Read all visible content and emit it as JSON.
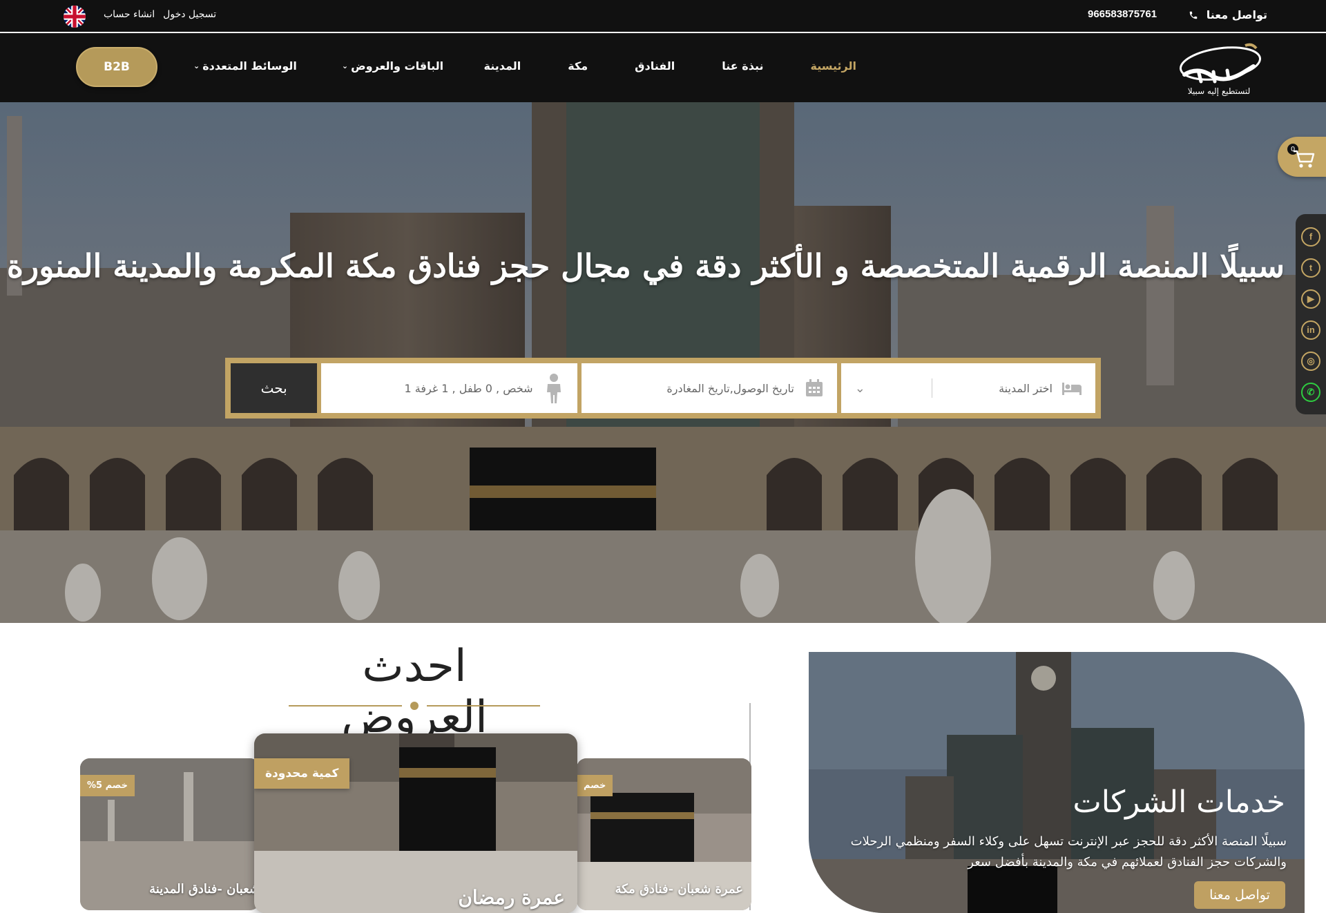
{
  "topbar": {
    "contact_label": "تواصل معنا",
    "phone": "966583875761",
    "login_label": "تسجيل دخول",
    "register_label": "انشاء حساب",
    "language_icon": "uk-flag-icon"
  },
  "logo": {
    "tagline": "لتستطيع إليه سبيلا"
  },
  "nav": {
    "items": [
      {
        "label": "الرئيسية",
        "active": true
      },
      {
        "label": "نبذة عنا"
      },
      {
        "label": "الفنادق"
      },
      {
        "label": "مكة"
      },
      {
        "label": "المدينة"
      },
      {
        "label": "الباقات والعروض",
        "dropdown": true
      },
      {
        "label": "الوسائط المتعددة",
        "dropdown": true
      }
    ],
    "b2b_label": "B2B"
  },
  "hero": {
    "title": "سبيلًا المنصة الرقمية المتخصصة و الأكثر دقة في مجال حجز فنادق مكة المكرمة والمدينة المنورة",
    "search": {
      "city_placeholder": "اختر المدينة",
      "dates_placeholder": "تاريخ الوصول,تاريخ المغادرة",
      "guests_value": "1 شخص , 0 طفل , 1 غرفة",
      "search_button": "بحث"
    }
  },
  "cart": {
    "count": "0"
  },
  "social": [
    "facebook-icon",
    "twitter-icon",
    "youtube-icon",
    "linkedin-icon",
    "instagram-icon",
    "whatsapp-icon"
  ],
  "offers": {
    "title": "احدث العروض",
    "cards": [
      {
        "badge": "خصم 5%",
        "caption": "شعبان -فنادق المدينة"
      },
      {
        "badge": "كمية محدودة",
        "caption": "عمرة رمضان"
      },
      {
        "badge": "خصم",
        "caption": "عمرة شعبان -فنادق مكة"
      }
    ]
  },
  "corporate": {
    "title": "خدمات الشركات",
    "text": "سبيلًا المنصة الأكثر دقة للحجز عبر الإنترنت تسهل على وكلاء السفر ومنظمي الرحلات والشركات حجز الفنادق لعملائهم في مكة والمدينة بأفضل سعر",
    "button": "تواصل معنا"
  },
  "colors": {
    "gold": "#c4a664",
    "dark": "#111111",
    "search_button": "#2f2f2f"
  }
}
